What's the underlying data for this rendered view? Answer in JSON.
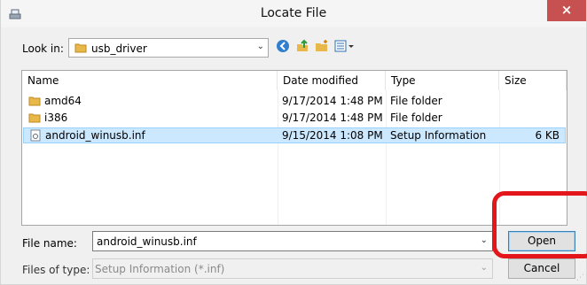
{
  "window": {
    "title": "Locate File",
    "close_glyph": "×"
  },
  "look_in": {
    "label": "Look in:",
    "value": "usb_driver",
    "icon": "folder-icon"
  },
  "toolbar": {
    "icons": [
      "back-icon",
      "up-folder-icon",
      "new-folder-icon",
      "view-menu-icon"
    ]
  },
  "columns": [
    {
      "label": "Name"
    },
    {
      "label": "Date modified"
    },
    {
      "label": "Type"
    },
    {
      "label": "Size"
    }
  ],
  "files": [
    {
      "name": "amd64",
      "date": "9/17/2014 1:48 PM",
      "type": "File folder",
      "size": "",
      "icon": "folder-icon",
      "selected": false
    },
    {
      "name": "i386",
      "date": "9/17/2014 1:48 PM",
      "type": "File folder",
      "size": "",
      "icon": "folder-icon",
      "selected": false
    },
    {
      "name": "android_winusb.inf",
      "date": "9/15/2014 1:08 PM",
      "type": "Setup Information",
      "size": "6 KB",
      "icon": "setup-file-icon",
      "selected": true
    }
  ],
  "file_name": {
    "label": "File name:",
    "value": "android_winusb.inf"
  },
  "file_type": {
    "label": "Files of type:",
    "value": "Setup Information (*.inf)"
  },
  "buttons": {
    "open": "Open",
    "cancel": "Cancel"
  },
  "colors": {
    "selection": "#cce8ff",
    "close_button": "#c75050",
    "highlight": "#e3161b"
  }
}
